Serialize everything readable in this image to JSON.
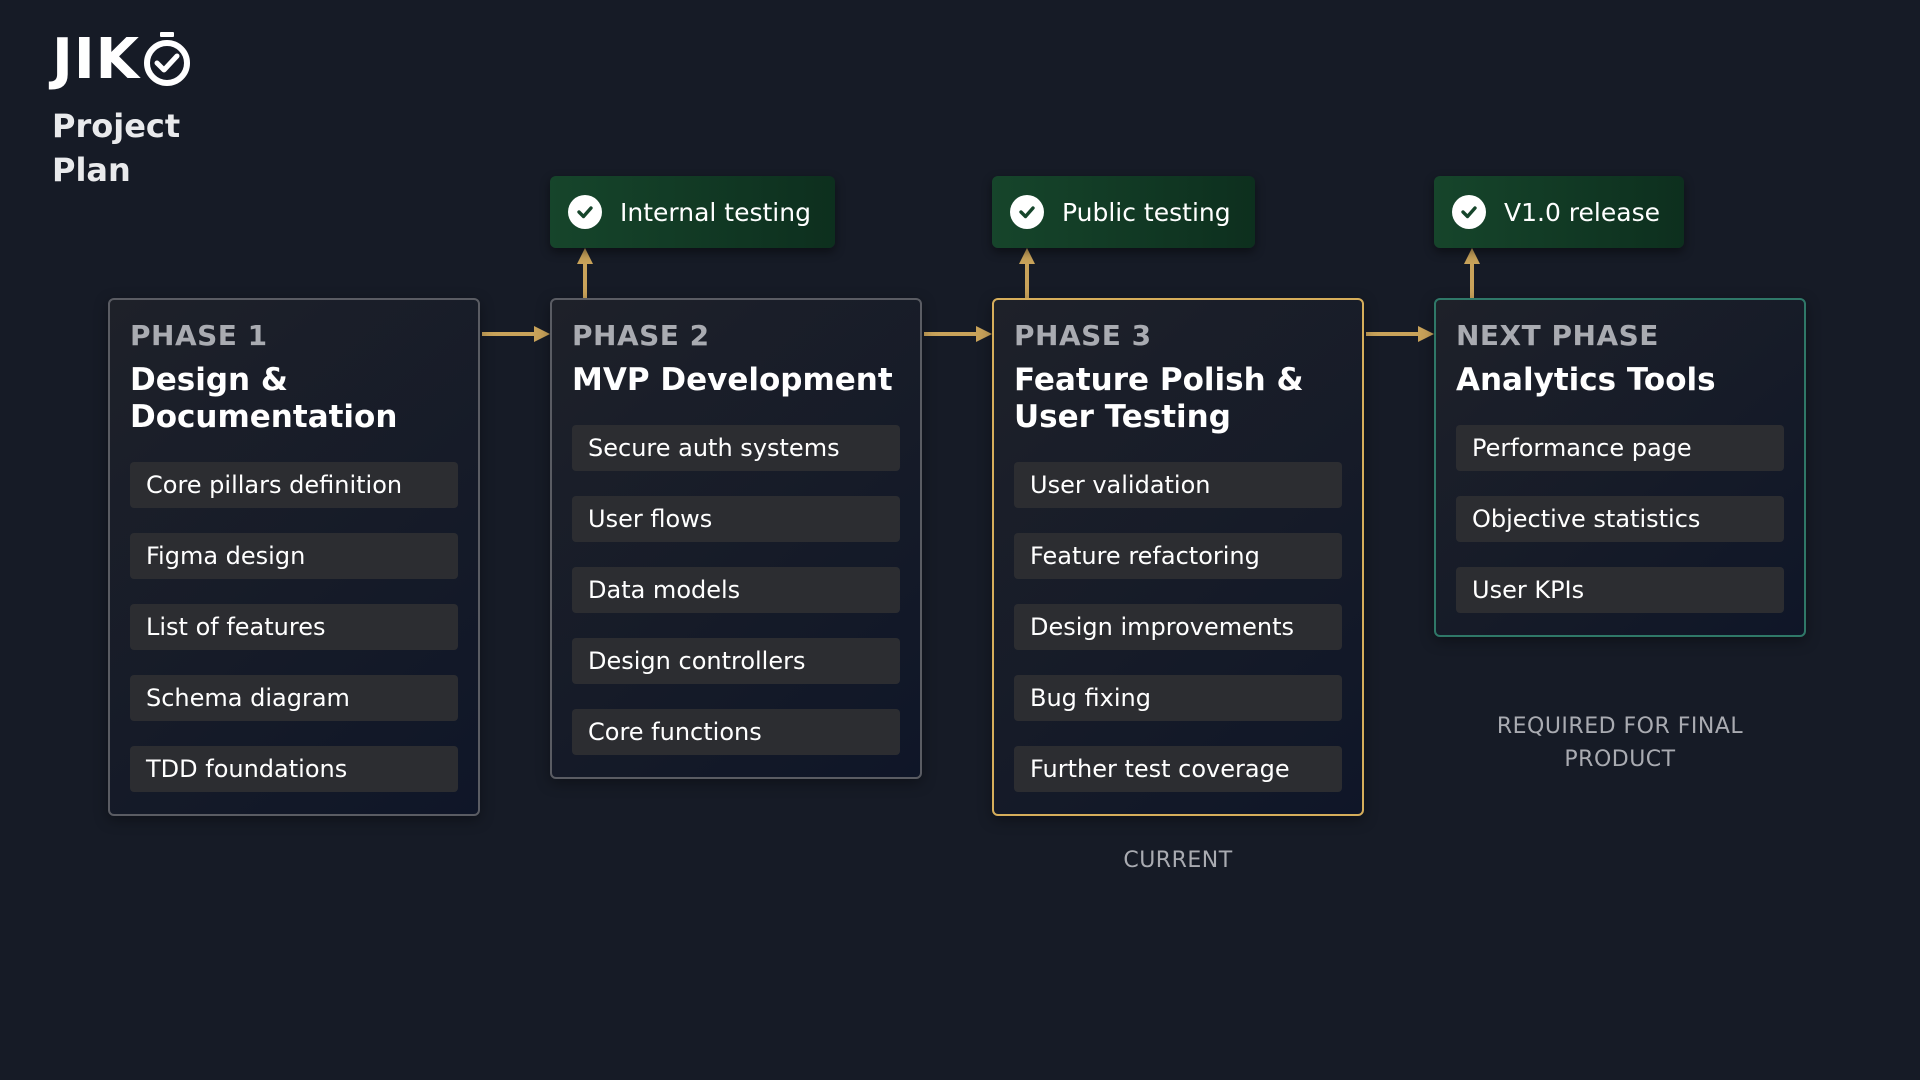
{
  "brand": {
    "logo_text": "JIK",
    "logo_icon": "stopwatch-check-icon"
  },
  "page_title": "Project Plan",
  "colors": {
    "background": "#161b26",
    "milestone_bg": "#16452b",
    "connector": "#c9a35a",
    "current_border": "#d6ae5b",
    "next_border": "#2f7868",
    "default_border": "#5a5c63",
    "task_bg": "#2c2d31"
  },
  "milestones": [
    {
      "label": "Internal testing",
      "icon": "check-circle-icon"
    },
    {
      "label": "Public testing",
      "icon": "check-circle-icon"
    },
    {
      "label": "V1.0 release",
      "icon": "check-circle-icon"
    }
  ],
  "phases": [
    {
      "kicker": "PHASE 1",
      "title": "Design & Documentation",
      "tasks": [
        "Core pillars definition",
        "Figma design",
        "List of features",
        "Schema diagram",
        "TDD foundations"
      ]
    },
    {
      "kicker": "PHASE 2",
      "title": "MVP Development",
      "tasks": [
        "Secure auth systems",
        "User flows",
        "Data models",
        "Design controllers",
        "Core functions"
      ]
    },
    {
      "kicker": "PHASE 3",
      "title": "Feature Polish & User Testing",
      "tasks": [
        "User validation",
        "Feature refactoring",
        "Design improvements",
        "Bug fixing",
        "Further test coverage"
      ]
    },
    {
      "kicker": "NEXT PHASE",
      "title": "Analytics Tools",
      "tasks": [
        "Performance page",
        "Objective statistics",
        "User KPIs"
      ]
    }
  ],
  "notes": {
    "current": "CURRENT",
    "required": "REQUIRED FOR FINAL PRODUCT"
  }
}
